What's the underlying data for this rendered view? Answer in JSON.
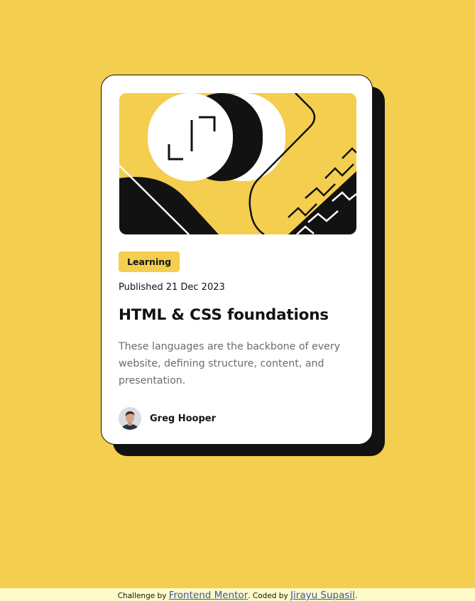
{
  "card": {
    "tag": "Learning",
    "published": "Published 21 Dec 2023",
    "title": "HTML & CSS foundations",
    "description": "These languages are the backbone of every website, defining structure, content, and presentation.",
    "author": {
      "name": "Greg Hooper"
    }
  },
  "footer": {
    "prefix": "Challenge by ",
    "link1": "Frontend Mentor",
    "middle": ". Coded by ",
    "link2": "Jirayu Supasil",
    "suffix": "."
  },
  "colors": {
    "background": "#F4CE4E",
    "card": "#FFFFFF",
    "ink": "#121212",
    "muted": "#6B6B6B",
    "footer_bg": "#FFFBC9",
    "link": "#3E52A3"
  },
  "icons": {
    "hero": "abstract-illustration",
    "avatar": "author-avatar"
  }
}
